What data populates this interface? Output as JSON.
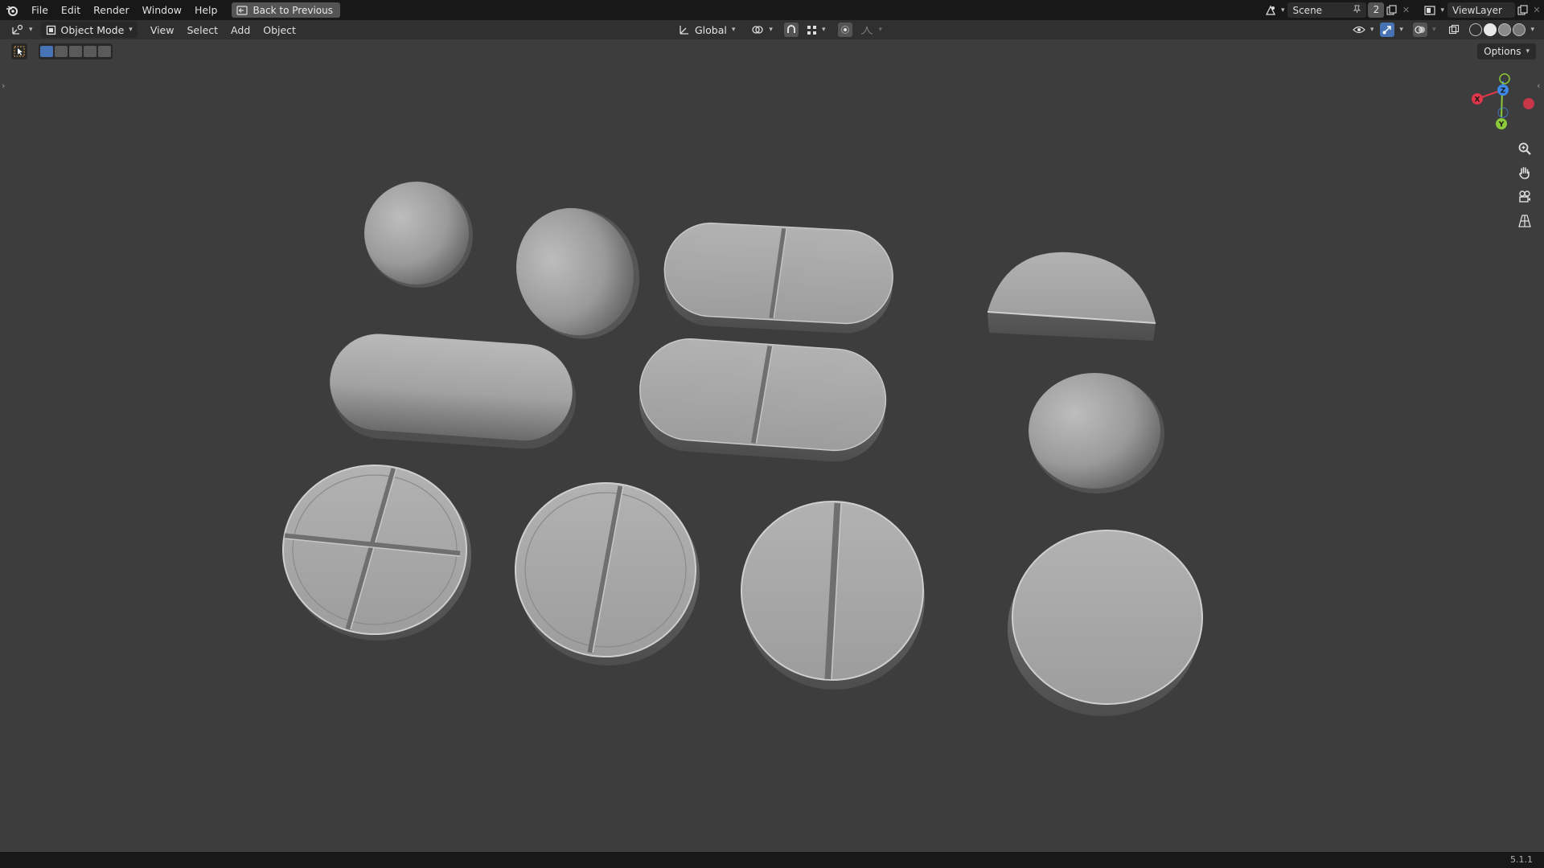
{
  "topbar": {
    "menus": [
      "File",
      "Edit",
      "Render",
      "Window",
      "Help"
    ],
    "back_button": "Back to Previous",
    "scene": "Scene",
    "scene_count": "2",
    "view_layer": "ViewLayer"
  },
  "header": {
    "mode": "Object Mode",
    "menus": [
      "View",
      "Select",
      "Add",
      "Object"
    ],
    "transform_orientation": "Global"
  },
  "viewport": {
    "options_label": "Options",
    "gizmo_axes": [
      "X",
      "Y",
      "Z"
    ],
    "objects": [
      "sphere-pill",
      "oval-pill",
      "scored-oblong-tablet",
      "half-round-tablet",
      "capsule",
      "scored-oblong-tablet",
      "round-pill",
      "cross-scored-round-tablet",
      "scored-round-tablet",
      "scored-round-tablet",
      "plain-round-tablet"
    ]
  },
  "status": {
    "version": "5.1.1"
  },
  "colors": {
    "viewport_bg": "#3d3d3d",
    "topbar_bg": "#181818",
    "header_bg": "#303030",
    "accent": "#4772b3",
    "axis_x": "#e0364a",
    "axis_y": "#8bc93a",
    "axis_z": "#3f88e6"
  }
}
